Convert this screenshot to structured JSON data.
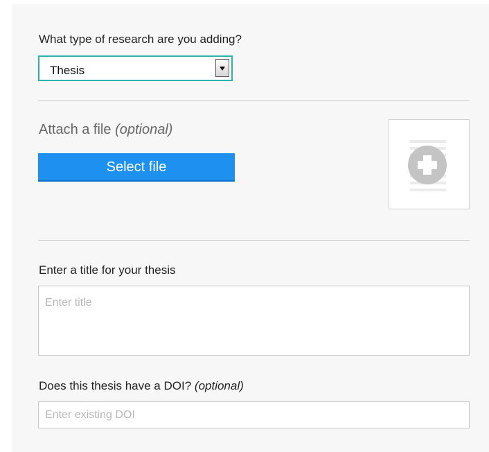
{
  "research_type": {
    "question": "What type of research are you adding?",
    "selected": "Thesis"
  },
  "attach": {
    "title": "Attach a file",
    "optional": "(optional)",
    "button_label": "Select file"
  },
  "title_field": {
    "label": "Enter a title for your thesis",
    "placeholder": "Enter title",
    "value": ""
  },
  "doi_field": {
    "label": "Does this thesis have a DOI?",
    "optional": "(optional)",
    "placeholder": "Enter existing DOI",
    "value": ""
  },
  "colors": {
    "accent_button": "#1e90ef",
    "select_border": "#2ab3ad",
    "panel_background": "#f7f7f7"
  },
  "icons": {
    "thumbnail": "add-file-plus-icon",
    "dropdown": "chevron-down-icon"
  }
}
